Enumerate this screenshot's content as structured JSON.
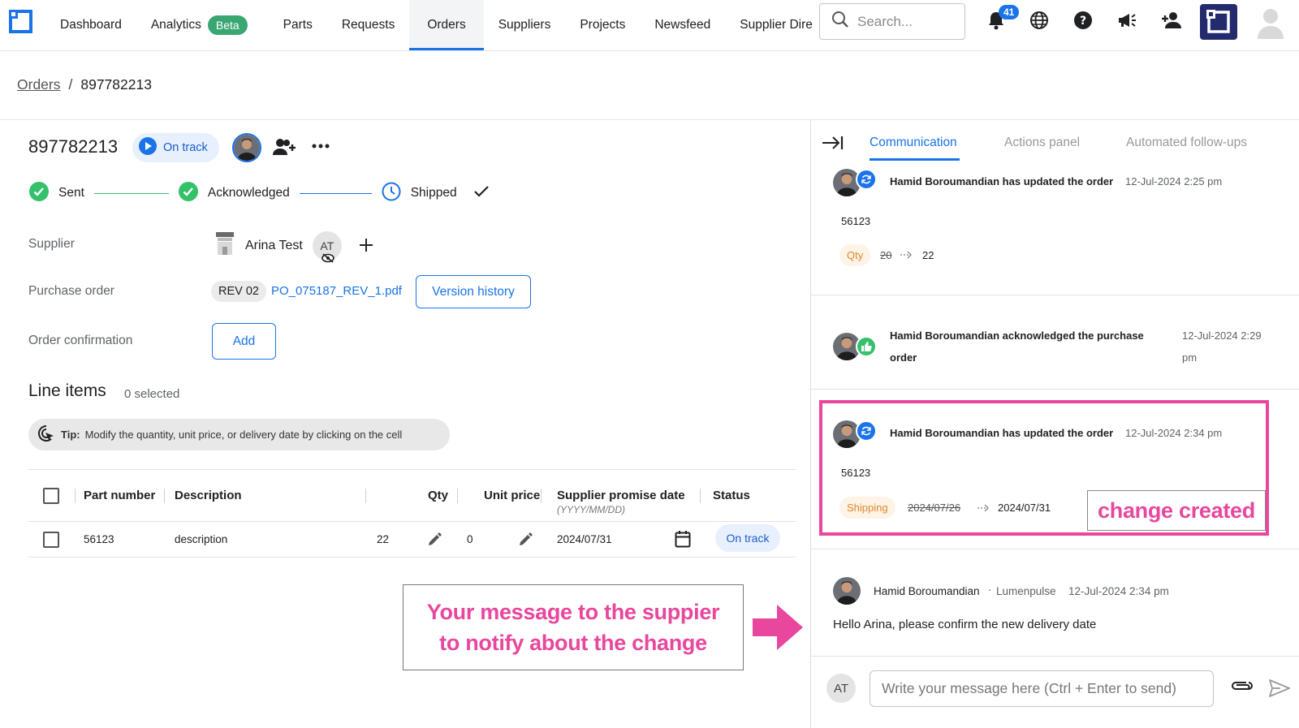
{
  "nav": {
    "items": [
      {
        "label": "Dashboard",
        "active": false
      },
      {
        "label": "Analytics",
        "active": false,
        "badge": "Beta"
      },
      {
        "label": "Parts",
        "active": false
      },
      {
        "label": "Requests",
        "active": false
      },
      {
        "label": "Orders",
        "active": true
      },
      {
        "label": "Suppliers",
        "active": false
      },
      {
        "label": "Projects",
        "active": false
      },
      {
        "label": "Newsfeed",
        "active": false
      },
      {
        "label": "Supplier Dire",
        "active": false
      }
    ],
    "search_placeholder": "Search...",
    "notification_count": "41",
    "icons": [
      "notification-bell-icon",
      "globe-icon",
      "help-icon",
      "megaphone-icon",
      "add-user-icon"
    ],
    "accent_color": "#1a73e8"
  },
  "breadcrumb": {
    "parent": "Orders",
    "separator": "/",
    "current": "897782213"
  },
  "order": {
    "id": "897782213",
    "status": "On track",
    "steps": [
      {
        "label": "Sent",
        "state": "done"
      },
      {
        "label": "Acknowledged",
        "state": "done"
      },
      {
        "label": "Shipped",
        "state": "current"
      }
    ],
    "supplier_label": "Supplier",
    "supplier_name": "Arina Test",
    "supplier_initials": "AT",
    "po_label": "Purchase order",
    "po_revision": "REV 02",
    "po_file": "PO_075187_REV_1.pdf",
    "version_history_label": "Version history",
    "confirmation_label": "Order confirmation",
    "add_label": "Add"
  },
  "line_items": {
    "title": "Line items",
    "selected_text": "0 selected",
    "tip_bold": "Tip:",
    "tip_text": "Modify the quantity, unit price, or delivery date by clicking on the cell",
    "columns": {
      "part_number": "Part number",
      "description": "Description",
      "qty": "Qty",
      "unit_price": "Unit price",
      "promise_date": "Supplier promise date",
      "promise_date_format": "(YYYY/MM/DD)",
      "status": "Status"
    },
    "rows": [
      {
        "part_number": "56123",
        "description": "description",
        "qty": "22",
        "unit_price": "0",
        "promise_date": "2024/07/31",
        "status": "On track"
      }
    ]
  },
  "annotations": {
    "message_note_line1": "Your message to the suppier",
    "message_note_line2": "to notify about the change",
    "change_created": "change created",
    "highlight_color": "#e8479d"
  },
  "panel": {
    "tabs": [
      {
        "label": "Communication",
        "active": true
      },
      {
        "label": "Actions panel",
        "active": false
      },
      {
        "label": "Automated follow-ups",
        "active": false
      }
    ],
    "activities": [
      {
        "text": "Hamid Boroumandian has updated the order",
        "time": "12-Jul-2024 2:25 pm",
        "badge": "sync-icon",
        "part": "56123",
        "field": "Qty",
        "old": "20",
        "new": "22"
      },
      {
        "text_line1": "Hamid Boroumandian acknowledged the purchase",
        "text_line2": "order",
        "time_line1": "12-Jul-2024 2:29",
        "time_line2": "pm",
        "badge": "thumbs-up-icon"
      },
      {
        "text": "Hamid Boroumandian has updated the order",
        "time": "12-Jul-2024 2:34 pm",
        "badge": "sync-icon",
        "part": "56123",
        "field": "Shipping",
        "old": "2024/07/26",
        "new": "2024/07/31"
      }
    ],
    "message": {
      "author": "Hamid Boroumandian",
      "org": "Lumenpulse",
      "time": "12-Jul-2024 2:34 pm",
      "body": "Hello Arina, please confirm the new delivery date"
    },
    "composer_initials": "AT",
    "composer_placeholder": "Write your message here (Ctrl + Enter to send)"
  }
}
